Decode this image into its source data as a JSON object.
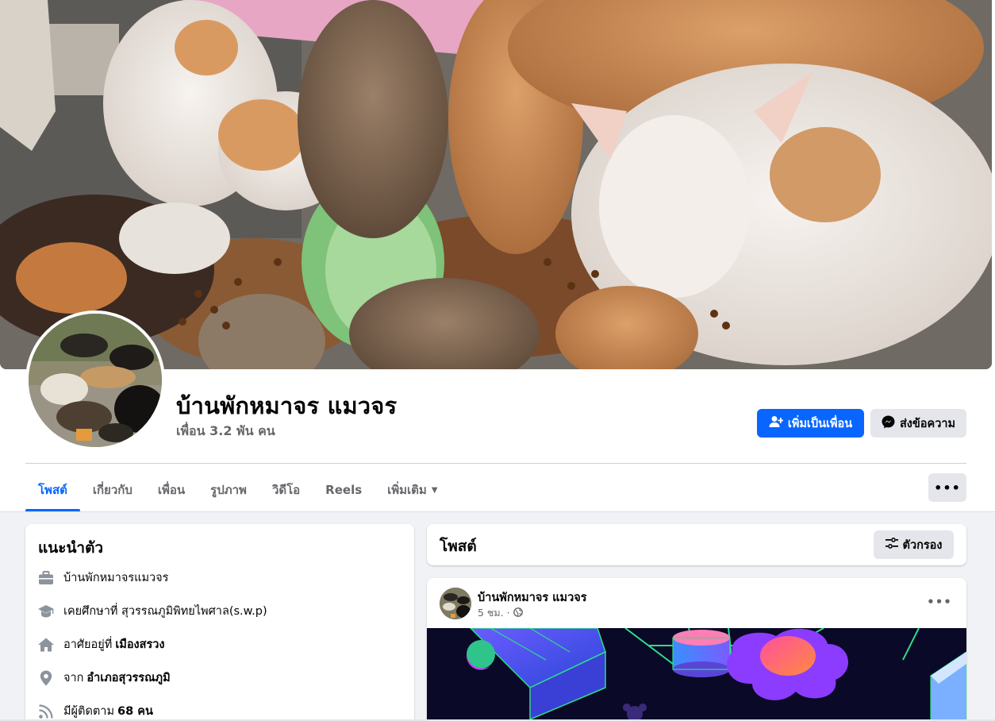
{
  "profile": {
    "name": "บ้านพักหมาจร แมวจร",
    "friends": "เพื่อน 3.2 พัน คน"
  },
  "actions": {
    "add_friend": "เพิ่มเป็นเพื่อน",
    "message": "ส่งข้อความ"
  },
  "tabs": [
    {
      "label": "โพสต์",
      "active": true
    },
    {
      "label": "เกี่ยวกับ"
    },
    {
      "label": "เพื่อน"
    },
    {
      "label": "รูปภาพ"
    },
    {
      "label": "วิดีโอ"
    },
    {
      "label": "Reels"
    },
    {
      "label": "เพิ่มเติม"
    }
  ],
  "more_tab_icon": "more-dots-icon",
  "intro": {
    "title": "แนะนำตัว",
    "work": "บ้านพักหมาจรแมวจร",
    "education": "เคยศึกษาที่ สุวรรณภูมิพิทยไพศาล(s.w.p)",
    "lives_prefix": "อาศัยอยู่ที่",
    "lives_place": "เมืองสรวง",
    "from_prefix": "จาก",
    "from_place": "อำเภอสุวรรณภูมิ",
    "followers_prefix": "มีผู้ติดตาม",
    "followers_count": "68 คน"
  },
  "posts_section": {
    "title": "โพสต์",
    "filter_label": "ตัวกรอง"
  },
  "post": {
    "author": "บ้านพักหมาจร แมวจร",
    "time": "5 ชม. ·"
  },
  "colors": {
    "accent": "#0866ff",
    "secondary_button": "#e4e6eb",
    "muted_text": "#65676b",
    "background": "#f0f2f5"
  }
}
